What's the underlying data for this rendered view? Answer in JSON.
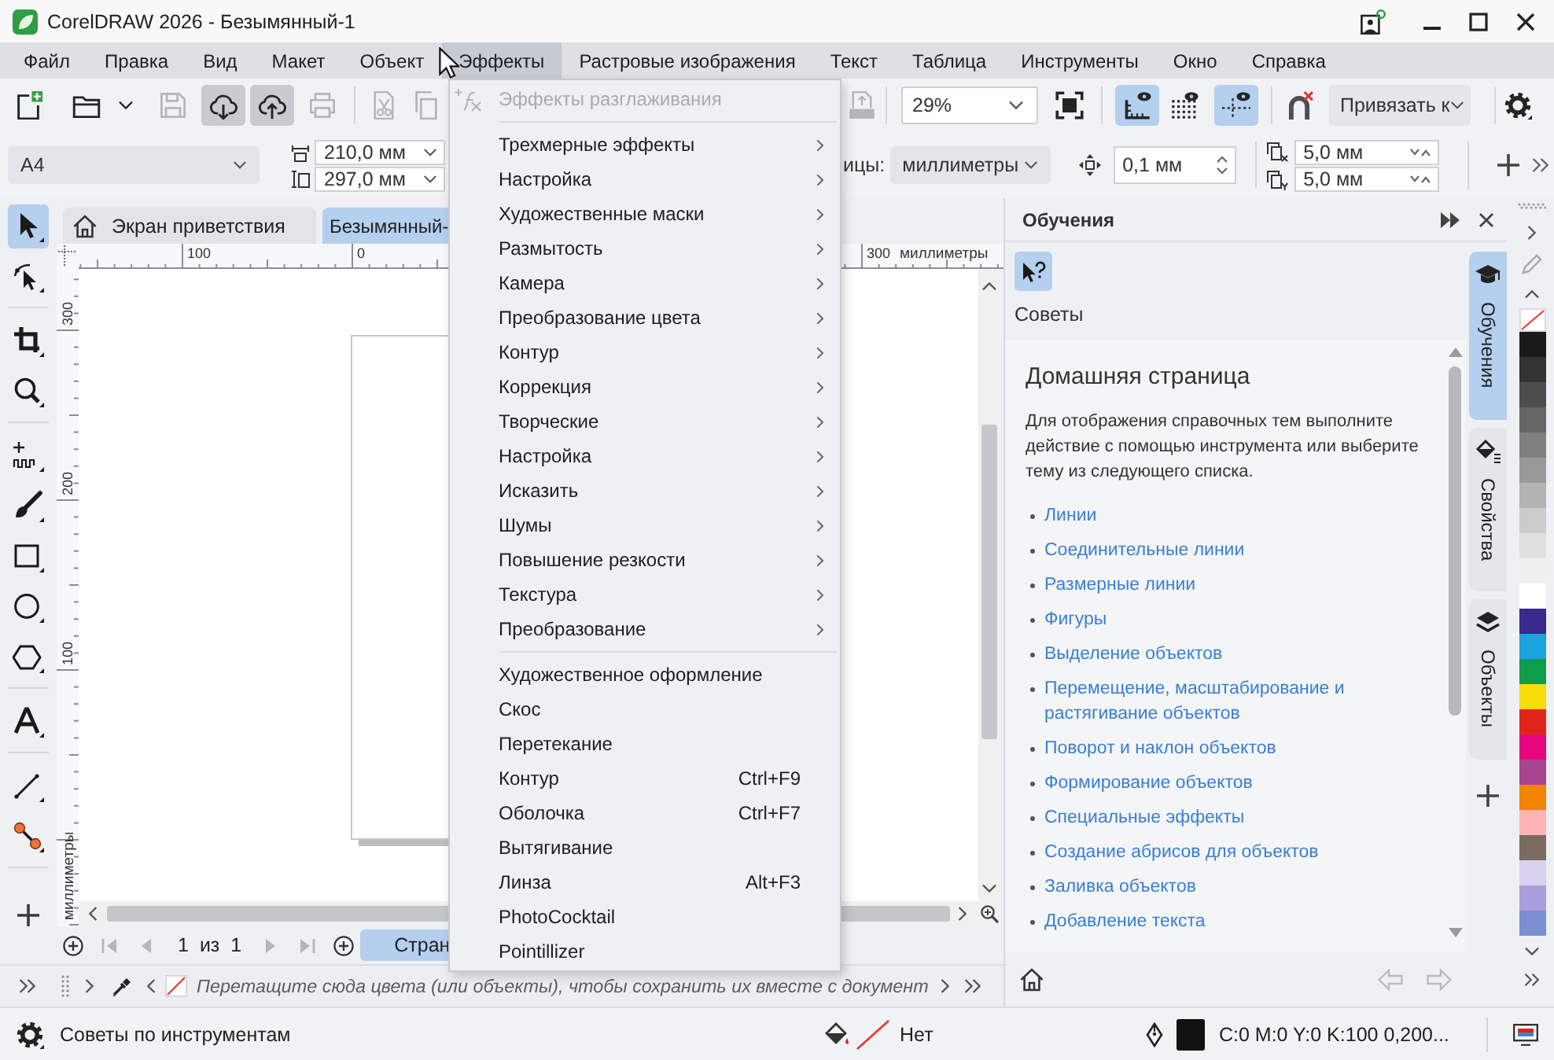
{
  "window": {
    "title": "CorelDRAW 2026 - Безымянный-1"
  },
  "menu_bar": [
    {
      "label": "Файл",
      "selected": false
    },
    {
      "label": "Правка",
      "selected": false
    },
    {
      "label": "Вид",
      "selected": false
    },
    {
      "label": "Макет",
      "selected": false
    },
    {
      "label": "Объект",
      "selected": false
    },
    {
      "label": "Эффекты",
      "selected": true
    },
    {
      "label": "Растровые изображения",
      "selected": false
    },
    {
      "label": "Текст",
      "selected": false
    },
    {
      "label": "Таблица",
      "selected": false
    },
    {
      "label": "Инструменты",
      "selected": false
    },
    {
      "label": "Окно",
      "selected": false
    },
    {
      "label": "Справка",
      "selected": false
    }
  ],
  "standard_toolbar": {
    "buttons": [
      {
        "on": false,
        "disabled": false
      },
      {
        "on": false,
        "disabled": false
      },
      {
        "on": false,
        "disabled": false
      },
      {
        "on": false,
        "disabled": true
      },
      {
        "on": true,
        "disabled": false
      },
      {
        "on": true,
        "disabled": false
      },
      {
        "on": false,
        "disabled": true
      },
      {
        "on": false,
        "disabled": true
      },
      {
        "on": false,
        "disabled": true
      },
      {
        "on": false,
        "disabled": true
      },
      {
        "on": false,
        "disabled": false
      },
      {
        "on": true,
        "disabled": false
      },
      {
        "on": false,
        "disabled": false
      },
      {
        "on": true,
        "disabled": false
      },
      {
        "on": false,
        "disabled": false
      },
      {
        "on": false,
        "disabled": false
      }
    ],
    "zoom": "29%",
    "snap_menu": "Привязать к"
  },
  "property_bar": {
    "page_size": "A4",
    "width": "210,0 мм",
    "height": "297,0 мм",
    "units_label": "ицы:",
    "units": "миллиметры",
    "nudge": "0,1 мм",
    "duplicate_x": "5,0 мм",
    "duplicate_y": "5,0 мм"
  },
  "toolbox": [
    {
      "selected": true
    },
    {
      "selected": false
    },
    {
      "selected": false
    },
    {
      "selected": false
    },
    {
      "selected": false
    },
    {
      "selected": false
    },
    {
      "selected": false
    },
    {
      "selected": false
    },
    {
      "selected": false
    },
    {
      "selected": false
    },
    {
      "selected": false
    },
    {
      "selected": false
    }
  ],
  "document_tabs": [
    {
      "label": "Экран приветствия",
      "selected": false
    },
    {
      "label": "Безымянный-",
      "selected": true
    }
  ],
  "horizontal_ruler": {
    "labels": [
      "100",
      "0",
      "300"
    ],
    "unit": "миллиметры"
  },
  "vertical_ruler": {
    "labels": [
      "300",
      "200",
      "100"
    ],
    "unit": "миллиметры"
  },
  "page_navigator": {
    "current": "1",
    "separator": "из",
    "total": "1",
    "page_tab": "Стран"
  },
  "color_docker": {
    "hint": "Перетащите сюда цвета (или объекты), чтобы сохранить их вместе с документ"
  },
  "effects_menu": {
    "sections": [
      {
        "items": [
          {
            "label": "Эффекты разглаживания",
            "disabled": true,
            "submenu": false
          }
        ]
      },
      {
        "items": [
          {
            "label": "Трехмерные эффекты",
            "disabled": false,
            "submenu": true
          },
          {
            "label": "Настройка",
            "disabled": false,
            "submenu": true
          },
          {
            "label": "Художественные маски",
            "disabled": false,
            "submenu": true
          },
          {
            "label": "Размытость",
            "disabled": false,
            "submenu": true
          },
          {
            "label": "Камера",
            "disabled": false,
            "submenu": true
          },
          {
            "label": "Преобразование цвета",
            "disabled": false,
            "submenu": true
          },
          {
            "label": "Контур",
            "disabled": false,
            "submenu": true
          },
          {
            "label": "Коррекция",
            "disabled": false,
            "submenu": true
          },
          {
            "label": "Творческие",
            "disabled": false,
            "submenu": true
          },
          {
            "label": "Настройка",
            "disabled": false,
            "submenu": true
          },
          {
            "label": "Исказить",
            "disabled": false,
            "submenu": true
          },
          {
            "label": "Шумы",
            "disabled": false,
            "submenu": true
          },
          {
            "label": "Повышение резкости",
            "disabled": false,
            "submenu": true
          },
          {
            "label": "Текстура",
            "disabled": false,
            "submenu": true
          },
          {
            "label": "Преобразование",
            "disabled": false,
            "submenu": true
          }
        ]
      },
      {
        "items": [
          {
            "label": "Художественное оформление",
            "disabled": false,
            "submenu": false
          },
          {
            "label": "Скос",
            "disabled": false,
            "submenu": false
          },
          {
            "label": "Перетекание",
            "disabled": false,
            "submenu": false
          },
          {
            "label": "Контур",
            "shortcut": "Ctrl+F9",
            "disabled": false,
            "submenu": false
          },
          {
            "label": "Оболочка",
            "shortcut": "Ctrl+F7",
            "disabled": false,
            "submenu": false
          },
          {
            "label": "Вытягивание",
            "disabled": false,
            "submenu": false
          },
          {
            "label": "Линза",
            "shortcut": "Alt+F3",
            "disabled": false,
            "submenu": false
          },
          {
            "label": "PhotoCocktail",
            "disabled": false,
            "submenu": false
          },
          {
            "label": "Pointillizer",
            "disabled": false,
            "submenu": false
          }
        ]
      }
    ]
  },
  "docker": {
    "title": "Обучения",
    "hints_label": "Советы",
    "heading": "Домашняя страница",
    "intro": "Для отображения справочных тем выполните действие с помощью инструмента или выберите тему из следующего списка.",
    "links": [
      "Линии",
      "Соединительные линии",
      "Размерные линии",
      "Фигуры",
      "Выделение объектов",
      "Перемещение, масштабирование и растягивание объектов",
      "Поворот и наклон объектов",
      "Формирование объектов",
      "Специальные эффекты",
      "Создание абрисов для объектов",
      "Заливка объектов",
      "Добавление текста"
    ]
  },
  "docker_tabs": [
    {
      "label": "Обучения",
      "selected": true
    },
    {
      "label": "Свойства",
      "selected": false
    },
    {
      "label": "Объекты",
      "selected": false
    }
  ],
  "palette": [
    {
      "color": "#1a1a1a"
    },
    {
      "color": "#333333"
    },
    {
      "color": "#4d4d4d"
    },
    {
      "color": "#666666"
    },
    {
      "color": "#808080"
    },
    {
      "color": "#999999"
    },
    {
      "color": "#b3b3b3"
    },
    {
      "color": "#cccccc"
    },
    {
      "color": "#e0e0e0"
    },
    {
      "color": "#efefef"
    },
    {
      "color": "#ffffff"
    },
    {
      "color": "#3a2a8c"
    },
    {
      "color": "#1aa3dc"
    },
    {
      "color": "#0f9d4a"
    },
    {
      "color": "#f6dd0a"
    },
    {
      "color": "#e0261c"
    },
    {
      "color": "#e6067f"
    },
    {
      "color": "#a8458f"
    },
    {
      "color": "#f18500"
    },
    {
      "color": "#ffb4b6"
    },
    {
      "color": "#7b6b63"
    },
    {
      "color": "#d8d2ee"
    },
    {
      "color": "#aa9fda"
    },
    {
      "color": "#7b8ed1"
    }
  ],
  "status_bar": {
    "hint": "Советы по инструментам",
    "fill": "Нет",
    "outline": "C:0 M:0 Y:0 K:100 0,200..."
  }
}
